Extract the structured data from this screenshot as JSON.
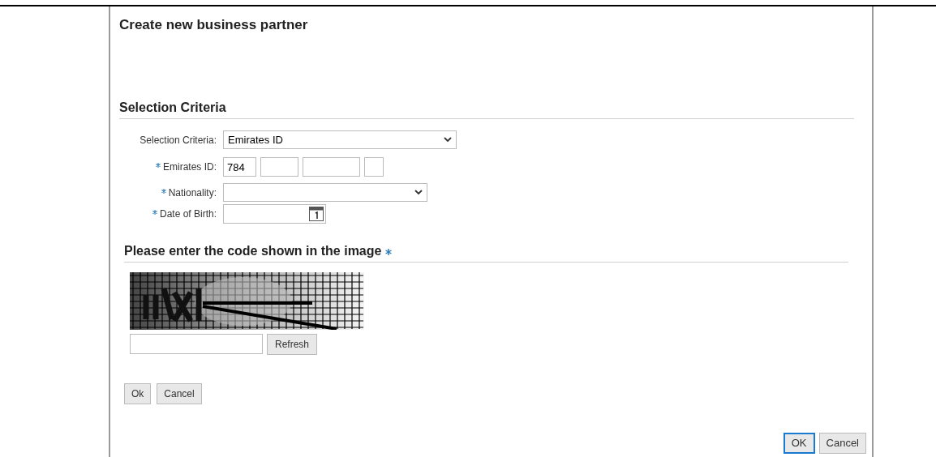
{
  "dialog": {
    "title": "Create new business partner"
  },
  "selection_section": {
    "heading": "Selection Criteria",
    "fields": [
      {
        "kind": "select",
        "label": "Selection Criteria:",
        "required": false,
        "value": "Emirates ID"
      },
      {
        "kind": "segmented",
        "label": "Emirates ID:",
        "required": true,
        "values": [
          "784"
        ]
      },
      {
        "kind": "select",
        "label": "Nationality:",
        "required": true
      },
      {
        "kind": "date",
        "label": "Date of Birth:",
        "required": true
      }
    ]
  },
  "captcha_section": {
    "heading": "Please enter the code shown in the image",
    "required": true,
    "refresh_button": "Refresh"
  },
  "form_buttons": [
    "Ok",
    "Cancel"
  ],
  "footer_buttons": [
    {
      "label": "OK",
      "focused": true
    },
    {
      "label": "Cancel",
      "focused": false
    }
  ]
}
